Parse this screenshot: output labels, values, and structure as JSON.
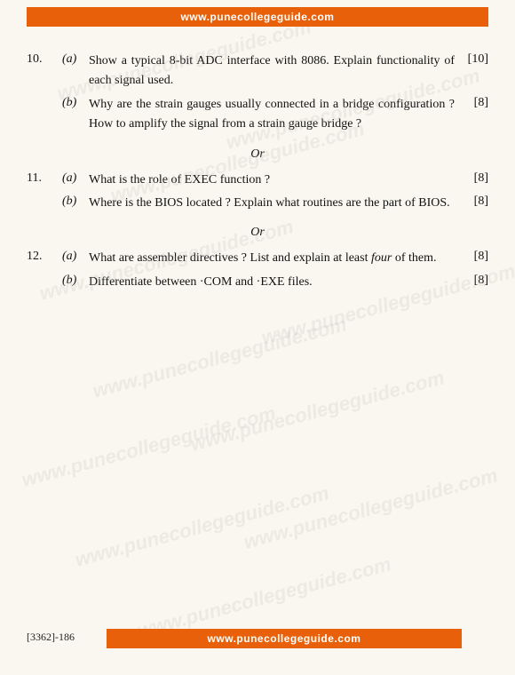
{
  "banners": {
    "top": "www.punecollegeguide.com",
    "bottom": "www.punecollegeguide.com"
  },
  "page_code": "[3362]-186",
  "watermark_text": "www.punecollegeguide.com",
  "or_label": "Or",
  "questions": [
    {
      "number": "10.",
      "parts": [
        {
          "part": "(a)",
          "text": "Show a typical 8-bit ADC interface with 8086. Explain functionality of each signal used.",
          "marks": "[10]"
        },
        {
          "part": "(b)",
          "text": "Why are the strain gauges usually connected in a bridge configuration ? How to amplify the signal from a strain gauge bridge ?",
          "marks": "[8]"
        }
      ]
    },
    {
      "or": true
    },
    {
      "number": "11.",
      "parts": [
        {
          "part": "(a)",
          "text": "What is the role of EXEC function ?",
          "marks": "[8]"
        },
        {
          "part": "(b)",
          "text": "Where is the BIOS located ? Explain what routines are the part of BIOS.",
          "marks": "[8]"
        }
      ]
    },
    {
      "or": true
    },
    {
      "number": "12.",
      "parts": [
        {
          "part": "(a)",
          "text_parts": [
            {
              "text": "What are assembler directives ? List and explain at least ",
              "italic": false
            },
            {
              "text": "four",
              "italic": true
            },
            {
              "text": " of them.",
              "italic": false
            }
          ],
          "marks": "[8]"
        },
        {
          "part": "(b)",
          "text": "Differentiate between ·COM and ·EXE files.",
          "marks": "[8]"
        }
      ]
    }
  ]
}
